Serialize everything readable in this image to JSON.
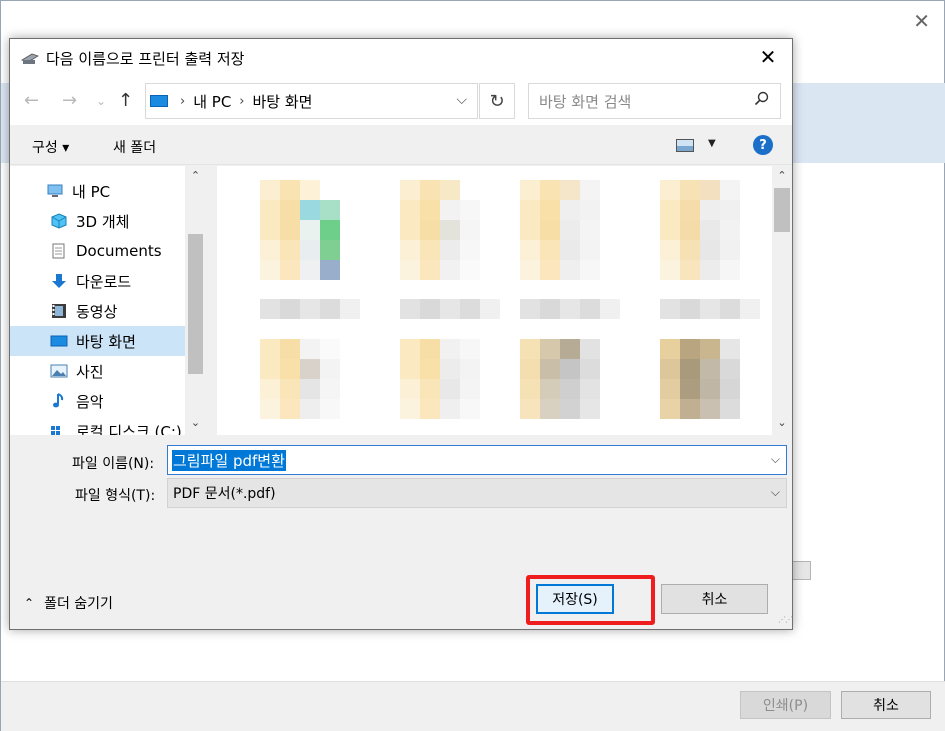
{
  "background_window": {
    "print_button": "인쇄(P)",
    "cancel_button": "취소"
  },
  "dialog": {
    "title": "다음 이름으로 프린터 출력 저장",
    "address": {
      "crumbs": [
        "내 PC",
        "바탕 화면"
      ]
    },
    "search_placeholder": "바탕 화면 검색",
    "toolbar": {
      "organize": "구성 ▾",
      "new_folder": "새 폴더",
      "help": "?"
    },
    "nav_items": [
      {
        "label": "내 PC",
        "icon": "pc-icon"
      },
      {
        "label": "3D 개체",
        "icon": "3d-objects-icon"
      },
      {
        "label": "Documents",
        "icon": "documents-icon"
      },
      {
        "label": "다운로드",
        "icon": "download-icon"
      },
      {
        "label": "동영상",
        "icon": "video-icon"
      },
      {
        "label": "바탕 화면",
        "icon": "desktop-icon",
        "selected": true
      },
      {
        "label": "사진",
        "icon": "pictures-icon"
      },
      {
        "label": "음악",
        "icon": "music-icon"
      },
      {
        "label": "로컬 디스크 (C:)",
        "icon": "disk-icon"
      }
    ],
    "filename_label": "파일 이름(N):",
    "filename_value": "그림파일 pdf변환",
    "filetype_label": "파일 형식(T):",
    "filetype_value": "PDF 문서(*.pdf)",
    "hide_folders": "폴더 숨기기",
    "save_button": "저장(S)",
    "cancel_button": "취소"
  },
  "colors": {
    "accent": "#0078d7",
    "highlight": "#ef1d1d",
    "selection": "#cce4f7"
  }
}
